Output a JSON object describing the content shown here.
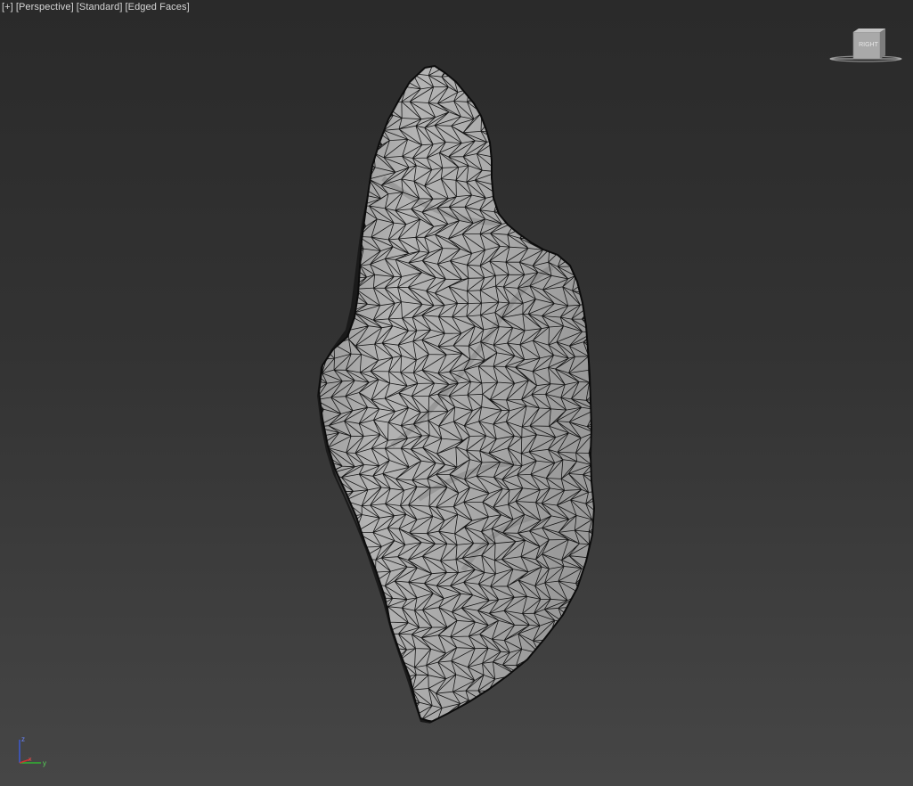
{
  "viewport": {
    "labels": [
      "[+]",
      "[Perspective]",
      "[Standard]",
      "[Edged Faces]"
    ]
  },
  "viewcube": {
    "face_label": "RIGHT",
    "icon": "viewcube-icon"
  },
  "axis_tripod": {
    "icon": "axis-tripod-icon",
    "x_label": "x",
    "y_label": "y",
    "z_label": "z"
  },
  "colors": {
    "bg_top": "#2a2a2a",
    "bg_bottom": "#464646",
    "mesh_fill": "#ababab",
    "mesh_wire": "#141414",
    "axis_x": "#c83232",
    "axis_y": "#32b432",
    "axis_z": "#3c5ad2"
  }
}
